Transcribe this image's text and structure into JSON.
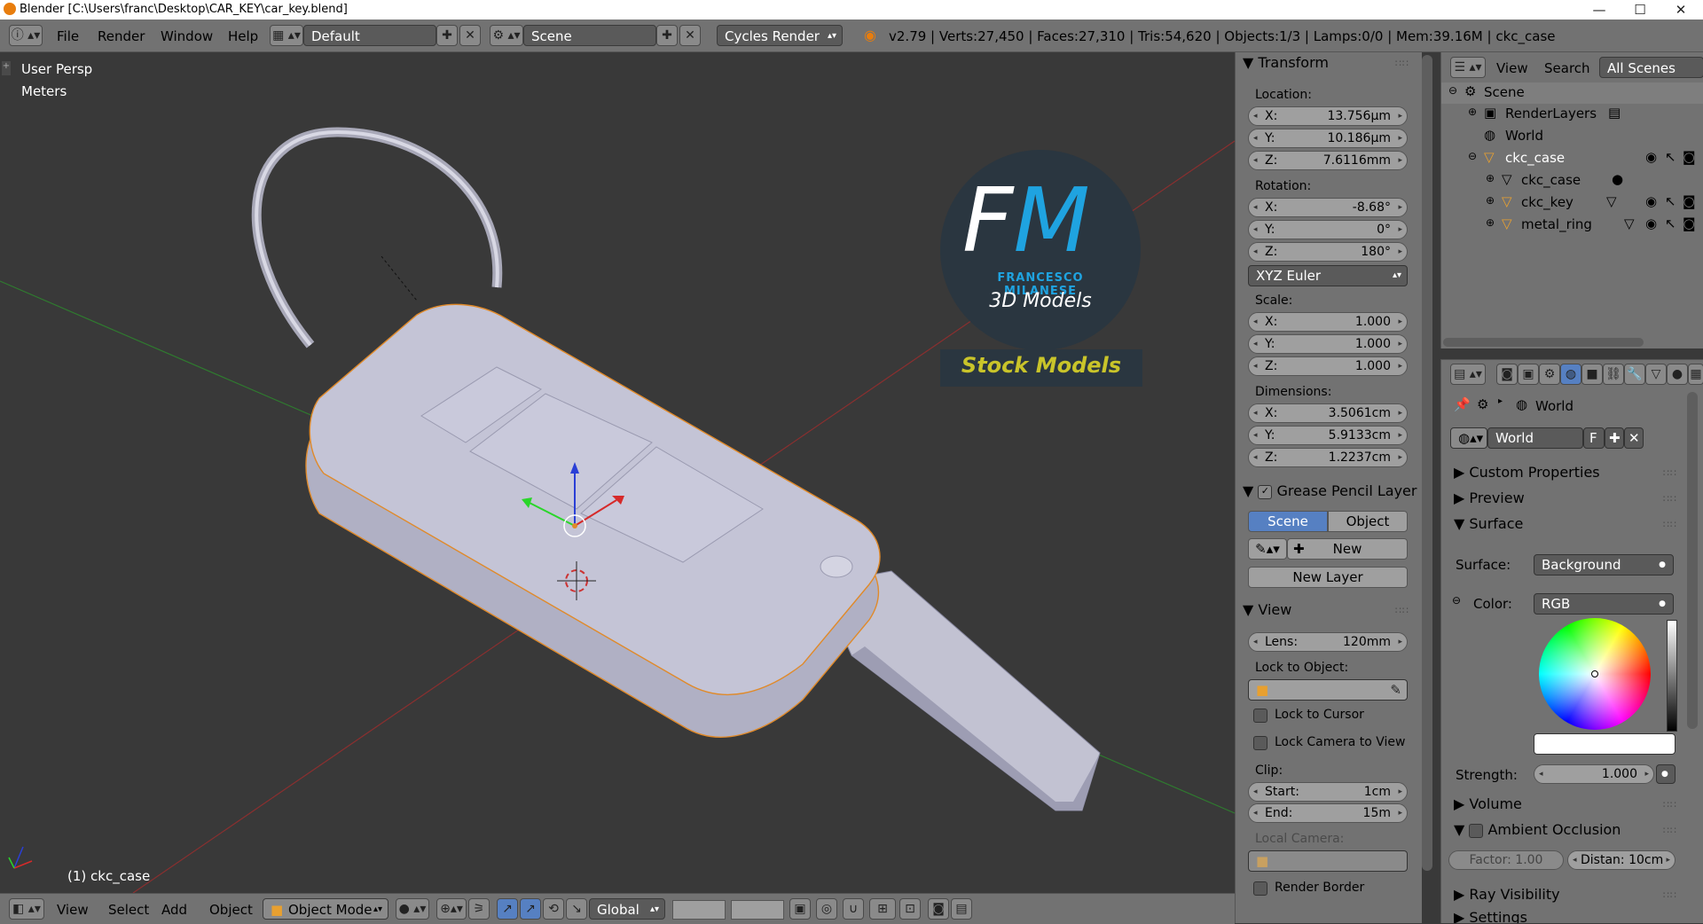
{
  "window": {
    "title": "Blender [C:\\Users\\franc\\Desktop\\CAR_KEY\\car_key.blend]",
    "minimize": "—",
    "maximize": "☐",
    "close": "✕"
  },
  "info_header": {
    "menus": [
      "File",
      "Render",
      "Window",
      "Help"
    ],
    "screen_layout": "Default",
    "scene": "Scene",
    "render_engine": "Cycles Render",
    "stats": "v2.79 | Verts:27,450 | Faces:27,310 | Tris:54,620 | Objects:1/3 | Lamps:0/0 | Mem:39.16M | ckc_case"
  },
  "viewport": {
    "view_name": "User Persp",
    "units": "Meters",
    "active_object": "(1) ckc_case",
    "watermark": {
      "initials_f": "F",
      "initials_m": "M",
      "name": "FRANCESCO MILANESE",
      "subtitle": "3D Models",
      "banner": "Stock Models"
    }
  },
  "bottom_header": {
    "menus": [
      "View",
      "Select",
      "Add",
      "Object"
    ],
    "mode": "Object Mode",
    "orientation": "Global"
  },
  "npanel": {
    "transform_title": "Transform",
    "location_label": "Location:",
    "location": [
      {
        "axis": "X:",
        "value": "13.756µm"
      },
      {
        "axis": "Y:",
        "value": "10.186µm"
      },
      {
        "axis": "Z:",
        "value": "7.6116mm"
      }
    ],
    "rotation_label": "Rotation:",
    "rotation": [
      {
        "axis": "X:",
        "value": "-8.68°"
      },
      {
        "axis": "Y:",
        "value": "0°"
      },
      {
        "axis": "Z:",
        "value": "180°"
      }
    ],
    "rotation_mode": "XYZ Euler",
    "scale_label": "Scale:",
    "scale": [
      {
        "axis": "X:",
        "value": "1.000"
      },
      {
        "axis": "Y:",
        "value": "1.000"
      },
      {
        "axis": "Z:",
        "value": "1.000"
      }
    ],
    "dimensions_label": "Dimensions:",
    "dimensions": [
      {
        "axis": "X:",
        "value": "3.5061cm"
      },
      {
        "axis": "Y:",
        "value": "5.9133cm"
      },
      {
        "axis": "Z:",
        "value": "1.2237cm"
      }
    ],
    "grease_title": "Grease Pencil Layer",
    "grease_scene": "Scene",
    "grease_object": "Object",
    "grease_new": "New",
    "grease_new_layer": "New Layer",
    "view_title": "View",
    "lens_label": "Lens:",
    "lens_value": "120mm",
    "lock_to_object": "Lock to Object:",
    "lock_to_cursor": "Lock to Cursor",
    "lock_camera": "Lock Camera to View",
    "clip_label": "Clip:",
    "clip_start_label": "Start:",
    "clip_start": "1cm",
    "clip_end_label": "End:",
    "clip_end": "15m",
    "local_camera": "Local Camera:",
    "render_border": "Render Border"
  },
  "outliner": {
    "menus": [
      "View",
      "Search"
    ],
    "filter": "All Scenes",
    "items": [
      "Scene",
      "RenderLayers",
      "World",
      "ckc_case",
      "ckc_case",
      "ckc_key",
      "metal_ring"
    ]
  },
  "properties": {
    "breadcrumb": "World",
    "world_name": "World",
    "fake_user": "F",
    "custom_properties": "Custom Properties",
    "preview": "Preview",
    "surface_title": "Surface",
    "surface_label": "Surface:",
    "surface_value": "Background",
    "color_label": "Color:",
    "color_value": "RGB",
    "strength_label": "Strength:",
    "strength_value": "1.000",
    "volume": "Volume",
    "ambient_occlusion": "Ambient Occlusion",
    "factor": "Factor:  1.00",
    "distance": "Distan: 10cm",
    "ray_visibility": "Ray Visibility",
    "settings": "Settings"
  },
  "colors": {
    "panel": "#727272",
    "viewport_bg": "#393939",
    "accent_blue": "#5680c2",
    "watermark_blue": "#1fa3e0",
    "banner_yellow": "#c9c42a"
  }
}
